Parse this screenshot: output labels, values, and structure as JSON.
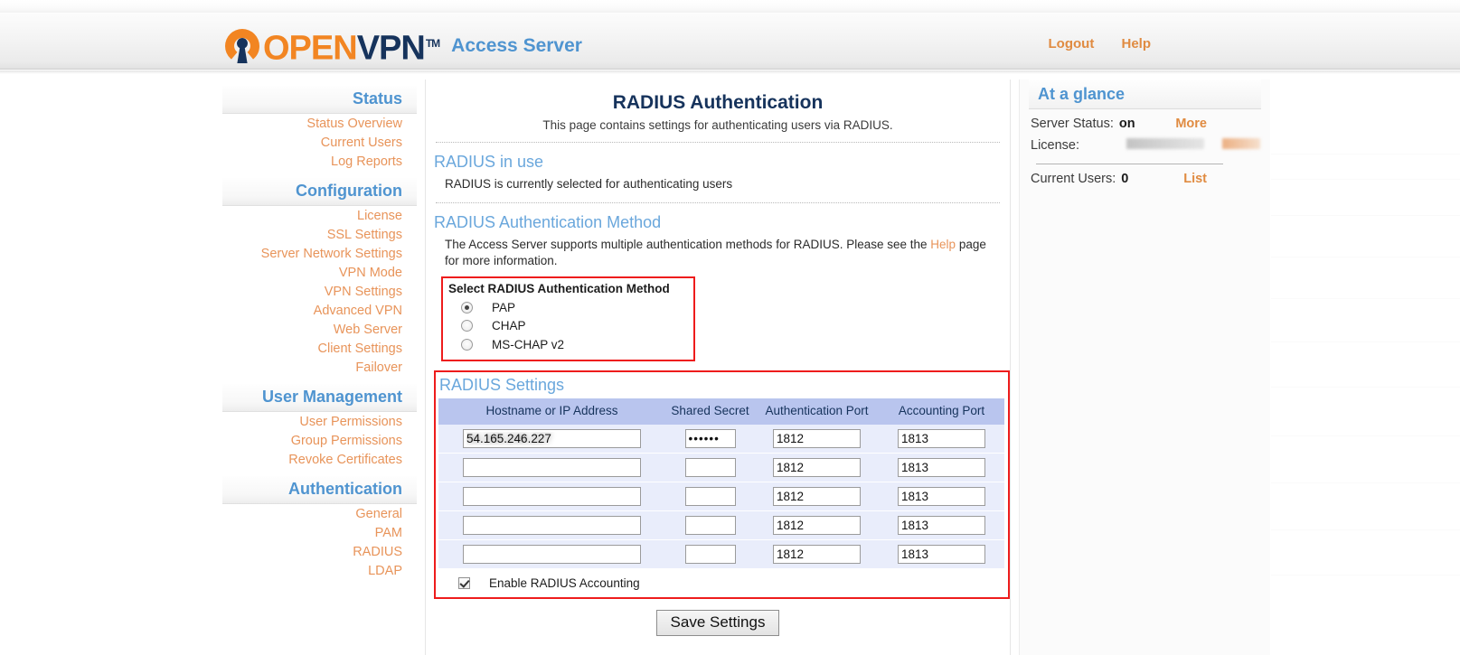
{
  "header": {
    "logo_open": "OPEN",
    "logo_vpn": "VPN",
    "logo_tm": "TM",
    "product": "Access Server",
    "links": [
      {
        "label": "Logout",
        "name": "logout-link"
      },
      {
        "label": "Help",
        "name": "help-link"
      }
    ]
  },
  "sidebar": {
    "sections": [
      {
        "title": "Status",
        "items": [
          "Status Overview",
          "Current Users",
          "Log Reports"
        ]
      },
      {
        "title": "Configuration",
        "items": [
          "License",
          "SSL Settings",
          "Server Network Settings",
          "VPN Mode",
          "VPN Settings",
          "Advanced VPN",
          "Web Server",
          "Client Settings",
          "Failover"
        ]
      },
      {
        "title": "User Management",
        "items": [
          "User Permissions",
          "Group Permissions",
          "Revoke Certificates"
        ]
      },
      {
        "title": "Authentication",
        "items": [
          "General",
          "PAM",
          "RADIUS",
          "LDAP"
        ]
      }
    ]
  },
  "main": {
    "title": "RADIUS Authentication",
    "subtitle": "This page contains settings for authenticating users via RADIUS.",
    "in_use": {
      "heading": "RADIUS in use",
      "text": "RADIUS is currently selected for authenticating users"
    },
    "method": {
      "heading": "RADIUS Authentication Method",
      "description_before": "The Access Server supports multiple authentication methods for RADIUS. Please see the",
      "description_link": "Help",
      "description_after": "page for more information.",
      "group_title": "Select RADIUS Authentication Method",
      "options": [
        {
          "label": "PAP",
          "selected": true
        },
        {
          "label": "CHAP",
          "selected": false
        },
        {
          "label": "MS-CHAP v2",
          "selected": false
        }
      ]
    },
    "settings": {
      "heading": "RADIUS Settings",
      "columns": [
        "Hostname or IP Address",
        "Shared Secret",
        "Authentication Port",
        "Accounting Port"
      ],
      "rows": [
        {
          "hostname": "",
          "hostname_redacted": true,
          "secret": "••••••",
          "auth_port": "1812",
          "acct_port": "1813"
        },
        {
          "hostname": "",
          "hostname_redacted": false,
          "secret": "",
          "auth_port": "1812",
          "acct_port": "1813"
        },
        {
          "hostname": "",
          "hostname_redacted": false,
          "secret": "",
          "auth_port": "1812",
          "acct_port": "1813"
        },
        {
          "hostname": "",
          "hostname_redacted": false,
          "secret": "",
          "auth_port": "1812",
          "acct_port": "1813"
        },
        {
          "hostname": "",
          "hostname_redacted": false,
          "secret": "",
          "auth_port": "1812",
          "acct_port": "1813"
        }
      ],
      "accounting_label": "Enable RADIUS Accounting",
      "accounting_checked": true
    },
    "save_label": "Save Settings"
  },
  "right_panel": {
    "title": "At a glance",
    "server_status_label": "Server Status:",
    "server_status_value": "on",
    "server_status_action": "More",
    "license_label": "License:",
    "current_users_label": "Current Users:",
    "current_users_value": "0",
    "current_users_action": "List"
  },
  "colors": {
    "brand_orange": "#f28522",
    "brand_navy": "#16335c",
    "link_orange": "#e8945a",
    "heading_blue": "#4f94d0",
    "section_blue": "#6aa7dc",
    "table_header_bg": "#b9c5ee",
    "table_row_bg": "#e9edfb",
    "annotation_red": "#ee1c1c"
  }
}
